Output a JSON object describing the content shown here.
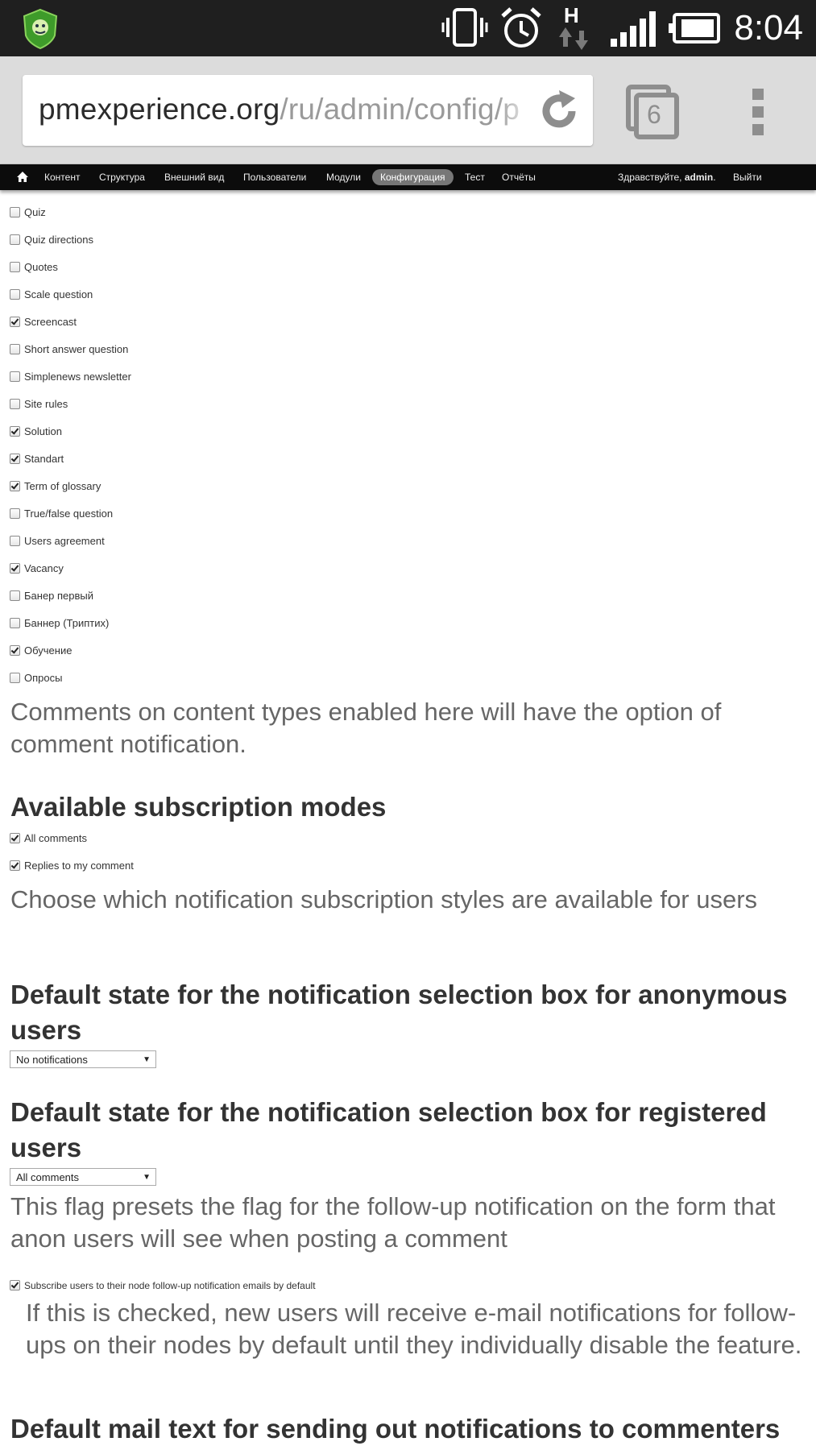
{
  "status_bar": {
    "time": "8:04",
    "network_label": "H",
    "icons": [
      "app-shield-icon",
      "vibrate-icon",
      "alarm-icon",
      "network-h-icon",
      "signal-icon",
      "battery-icon"
    ]
  },
  "browser": {
    "url_host": "pmexperience.org",
    "url_path": "/ru/admin/config/p",
    "tab_count": "6"
  },
  "toolbar": {
    "items": [
      "Контент",
      "Структура",
      "Внешний вид",
      "Пользователи",
      "Модули",
      "Конфигурация",
      "Тест",
      "Отчёты"
    ],
    "active": "Конфигурация",
    "greeting_prefix": "Здравствуйте, ",
    "username": "admin",
    "greeting_suffix": ".",
    "logout": "Выйти"
  },
  "content_types": [
    {
      "label": "Quiz",
      "checked": false
    },
    {
      "label": "Quiz directions",
      "checked": false
    },
    {
      "label": "Quotes",
      "checked": false
    },
    {
      "label": "Scale question",
      "checked": false
    },
    {
      "label": "Screencast",
      "checked": true
    },
    {
      "label": "Short answer question",
      "checked": false
    },
    {
      "label": "Simplenews newsletter",
      "checked": false
    },
    {
      "label": "Site rules",
      "checked": false
    },
    {
      "label": "Solution",
      "checked": true
    },
    {
      "label": "Standart",
      "checked": true
    },
    {
      "label": "Term of glossary",
      "checked": true
    },
    {
      "label": "True/false question",
      "checked": false
    },
    {
      "label": "Users agreement",
      "checked": false
    },
    {
      "label": "Vacancy",
      "checked": true
    },
    {
      "label": "Банер первый",
      "checked": false
    },
    {
      "label": "Баннер (Триптих)",
      "checked": false
    },
    {
      "label": "Обучение",
      "checked": true
    },
    {
      "label": "Опросы",
      "checked": false
    }
  ],
  "content_types_desc": "Comments on content types enabled here will have the option of comment notification.",
  "subscription_modes": {
    "heading": "Available subscription modes",
    "options": [
      {
        "label": "All comments",
        "checked": true
      },
      {
        "label": "Replies to my comment",
        "checked": true
      }
    ],
    "desc": "Choose which notification subscription styles are available for users"
  },
  "anon_default": {
    "heading": "Default state for the notification selection box for anonymous users",
    "value": "No notifications"
  },
  "registered_default": {
    "heading": "Default state for the notification selection box for registered users",
    "value": "All comments",
    "desc": "This flag presets the flag for the follow-up notification on the form that anon users will see when posting a comment"
  },
  "node_followup": {
    "label": "Subscribe users to their node follow-up notification emails by default",
    "checked": true,
    "desc": "If this is checked, new users will receive e-mail notifications for follow-ups on their nodes by default until they individually disable the feature."
  },
  "mail_text_heading": "Default mail text for sending out notifications to commenters"
}
